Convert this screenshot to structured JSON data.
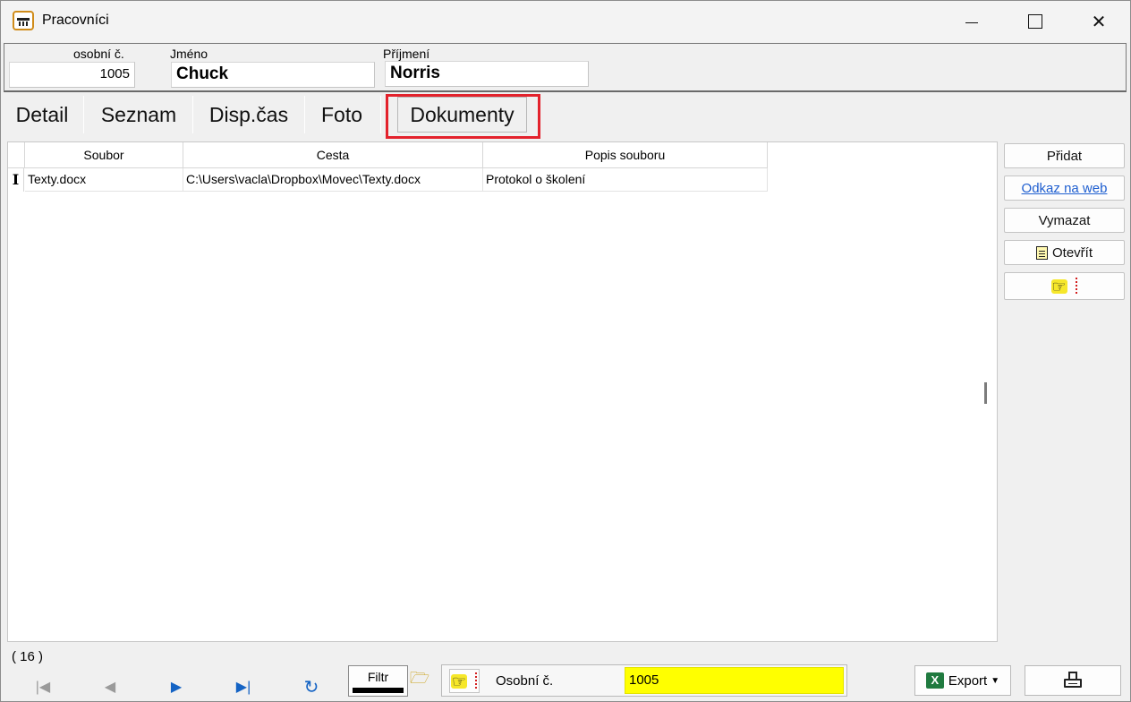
{
  "window": {
    "title": "Pracovníci",
    "minimize_glyph": "─",
    "maximize_glyph": "☐",
    "close_glyph": "✕"
  },
  "header": {
    "personal_no_label": "osobní č.",
    "personal_no_value": "1005",
    "first_name_label": "Jméno",
    "first_name_value": "Chuck",
    "last_name_label": "Příjmení",
    "last_name_value": "Norris"
  },
  "tabs": [
    {
      "label": "Detail"
    },
    {
      "label": "Seznam"
    },
    {
      "label": "Disp.čas"
    },
    {
      "label": "Foto"
    },
    {
      "label": "Dokumenty",
      "active": true
    }
  ],
  "grid": {
    "columns": [
      "Soubor",
      "Cesta",
      "Popis souboru"
    ],
    "rows": [
      {
        "indicator": "I",
        "cells": [
          "Texty.docx",
          "C:\\Users\\vacla\\Dropbox\\Movec\\Texty.docx",
          "Protokol o školení"
        ]
      }
    ]
  },
  "side_buttons": {
    "add": "Přidat",
    "web_link": "Odkaz na web",
    "delete": "Vymazat",
    "open": "Otevřít"
  },
  "footer": {
    "record_count": "( 16 )",
    "filter_label": "Filtr",
    "search_label": "Osobní č.",
    "search_value": "1005",
    "export_label": "Export",
    "nav": {
      "first": "|◀",
      "prev": "◀",
      "next": "▶",
      "last": "▶|",
      "refresh": "↻"
    }
  },
  "colors": {
    "highlight_border": "#e3222c",
    "search_bg": "#ffff00",
    "link": "#1f5fd0",
    "nav_blue": "#1463c4"
  },
  "icons": {
    "app": "app-logo-icon",
    "hand": "pointing-hand-icon",
    "folder": "folder-open-icon",
    "excel": "excel-icon",
    "printer": "printer-icon"
  }
}
